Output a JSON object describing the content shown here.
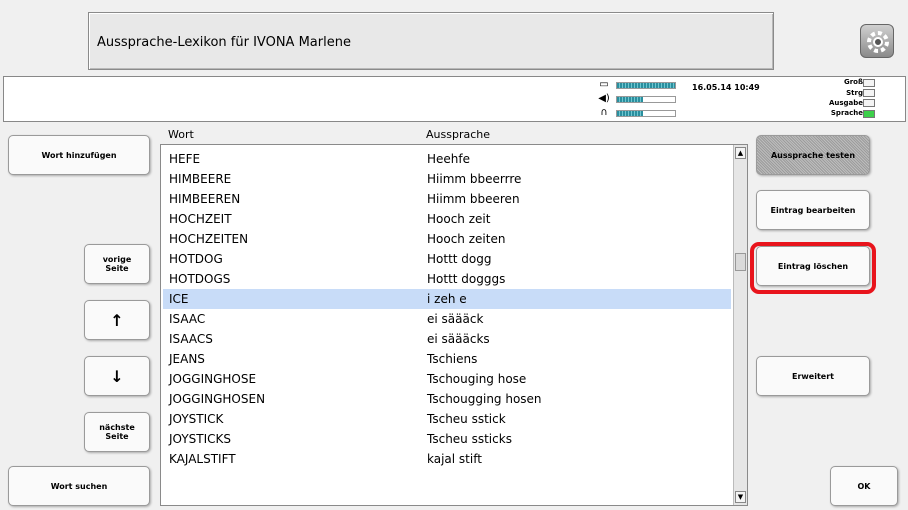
{
  "header": {
    "title": "Aussprache-Lexikon für IVONA Marlene"
  },
  "settings_icon": "gear-icon",
  "status": {
    "datetime": "16.05.14 10:49",
    "meters": [
      {
        "icon": "battery-icon",
        "level": 1.0
      },
      {
        "icon": "speaker-icon",
        "level": 0.45
      },
      {
        "icon": "headphones-icon",
        "level": 0.45
      }
    ],
    "flags": [
      {
        "label": "Groß",
        "on": false
      },
      {
        "label": "Strg",
        "on": false
      },
      {
        "label": "Ausgabe",
        "on": false
      },
      {
        "label": "Sprache",
        "on": true
      }
    ]
  },
  "left_buttons": {
    "add_word": "Wort hinzufügen",
    "prev_page": "vorige Seite",
    "up": "↑",
    "down": "↓",
    "next_page": "nächste Seite",
    "search_word": "Wort suchen"
  },
  "right_buttons": {
    "test": "Aussprache testen",
    "edit": "Eintrag bearbeiten",
    "delete": "Eintrag löschen",
    "advanced": "Erweitert",
    "ok": "OK"
  },
  "list": {
    "col_word": "Wort",
    "col_pron": "Aussprache",
    "selected_index": 7,
    "rows": [
      {
        "word": "HEFE",
        "pron": "Heehfe"
      },
      {
        "word": "HIMBEERE",
        "pron": "Hiimm bbeerrre"
      },
      {
        "word": "HIMBEEREN",
        "pron": "Hiimm bbeeren"
      },
      {
        "word": "HOCHZEIT",
        "pron": "Hooch zeit"
      },
      {
        "word": "HOCHZEITEN",
        "pron": "Hooch zeiten"
      },
      {
        "word": "HOTDOG",
        "pron": "Hottt dogg"
      },
      {
        "word": "HOTDOGS",
        "pron": "Hottt dogggs"
      },
      {
        "word": "ICE",
        "pron": "i zeh e"
      },
      {
        "word": "ISAAC",
        "pron": "ei säääck"
      },
      {
        "word": "ISAACS",
        "pron": "ei säääcks"
      },
      {
        "word": "JEANS",
        "pron": "Tschiens"
      },
      {
        "word": "JOGGINGHOSE",
        "pron": "Tschouging hose"
      },
      {
        "word": "JOGGINGHOSEN",
        "pron": "Tschougging hosen"
      },
      {
        "word": "JOYSTICK",
        "pron": "Tscheu sstick"
      },
      {
        "word": "JOYSTICKS",
        "pron": "Tscheu ssticks"
      },
      {
        "word": "KAJALSTIFT",
        "pron": "kajal stift"
      }
    ]
  },
  "colors": {
    "selection": "#c8dcf8",
    "highlight": "#e8141c",
    "active_flag": "#3cd04a"
  }
}
